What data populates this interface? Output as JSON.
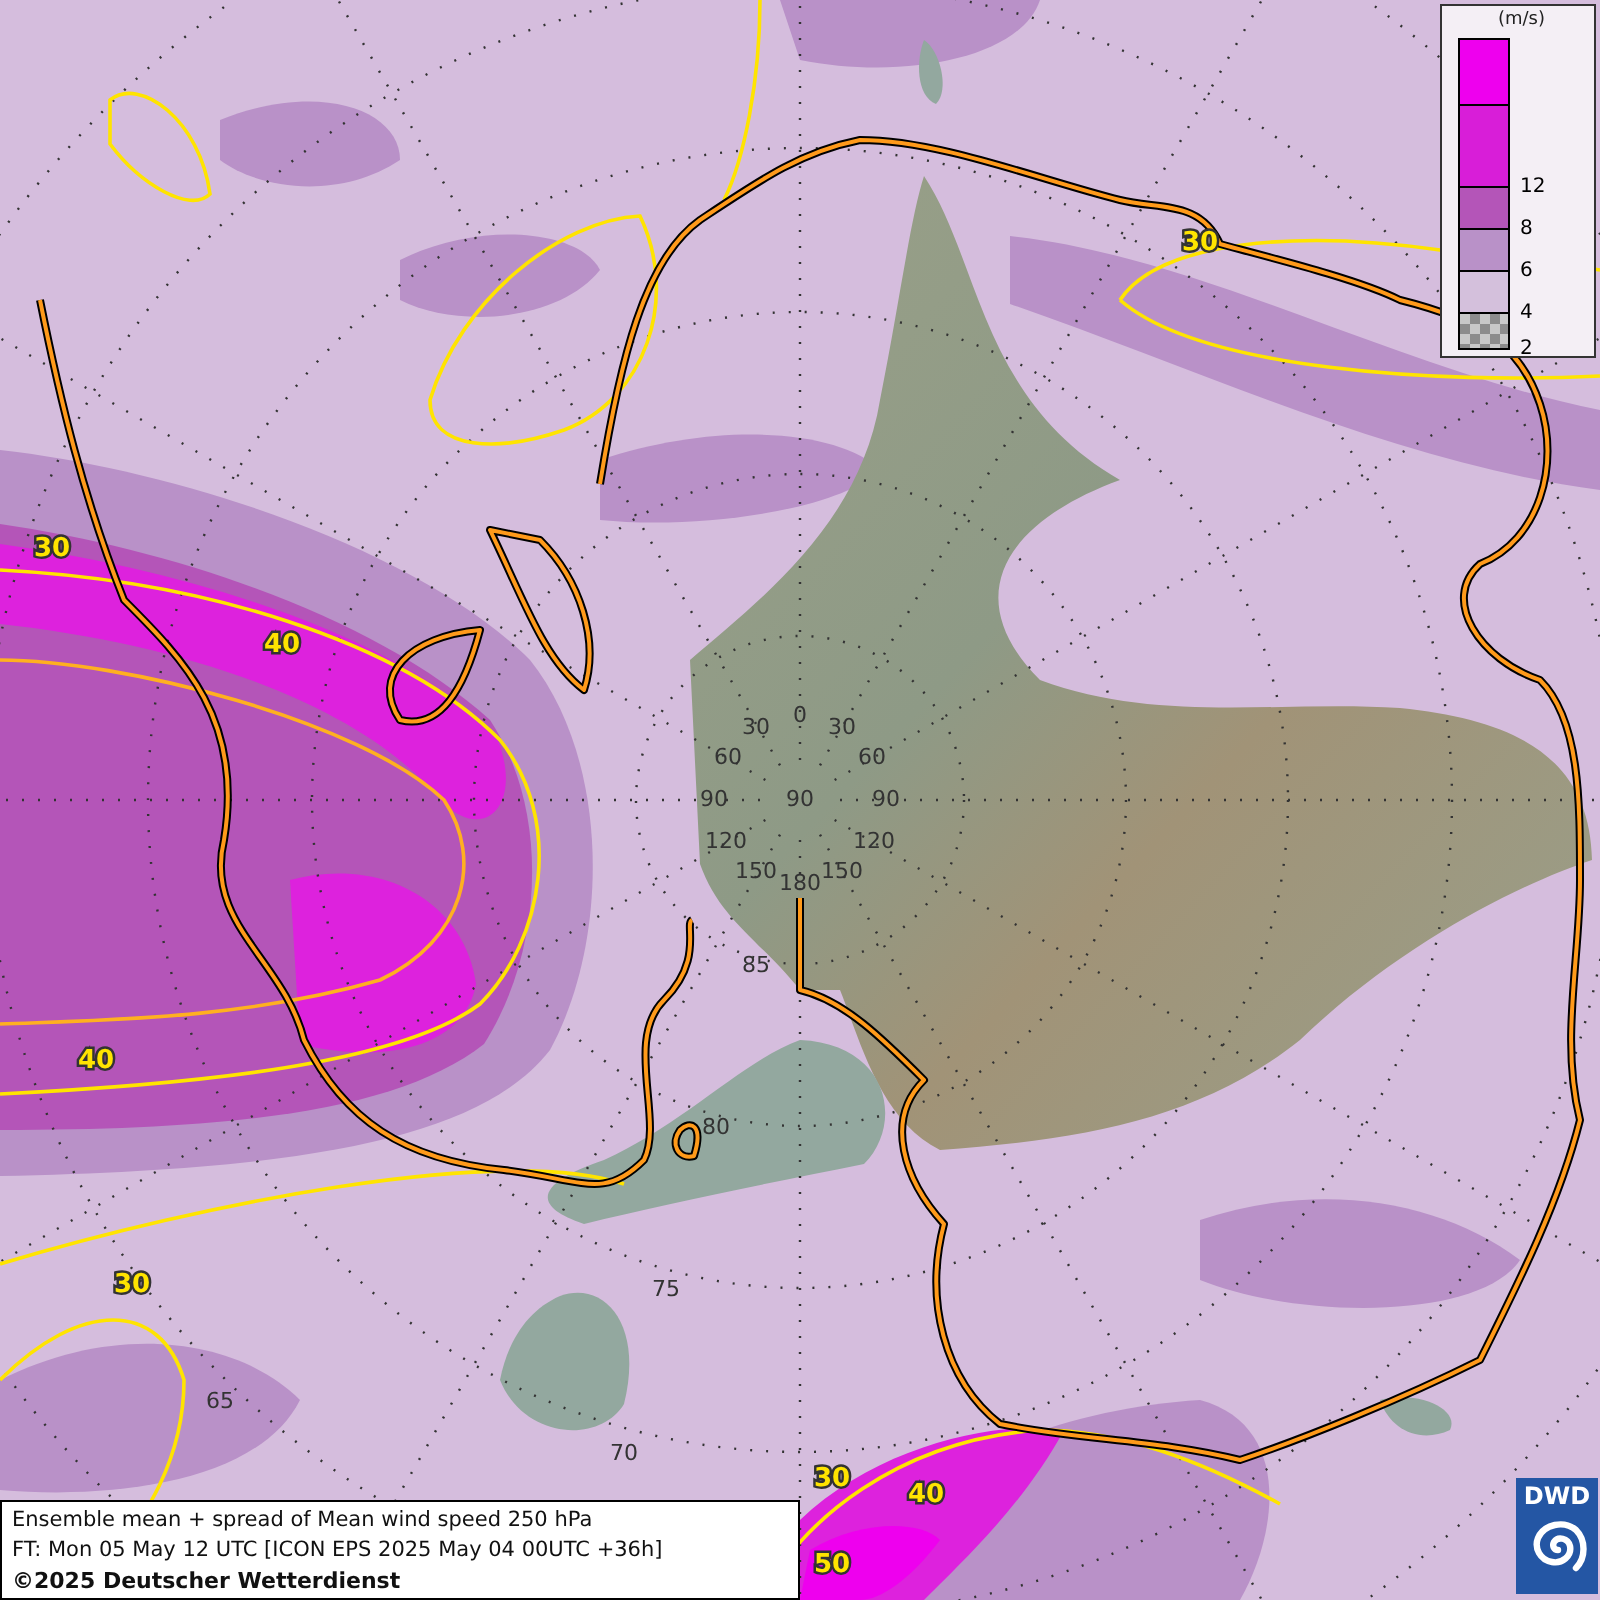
{
  "map": {
    "contour_labels": [
      "30",
      "30",
      "40",
      "40",
      "30",
      "30",
      "40",
      "50"
    ],
    "meridian_labels": [
      "0",
      "30",
      "30",
      "60",
      "60",
      "90",
      "90",
      "90",
      "120",
      "120",
      "150",
      "150",
      "180"
    ],
    "latitude_labels": [
      "85",
      "80",
      "75",
      "70",
      "65"
    ]
  },
  "legend": {
    "unit": "(m/s)",
    "bins": [
      {
        "kind": "solid",
        "color": "#ee00ee"
      },
      {
        "kind": "solid",
        "color": "#d81ed8",
        "tick": "12"
      },
      {
        "kind": "solid",
        "color": "#b455b8",
        "tick": "8"
      },
      {
        "kind": "solid",
        "color": "#b991c8",
        "tick": "6"
      },
      {
        "kind": "solid",
        "color": "#d4c0dc",
        "tick": "4"
      },
      {
        "kind": "checker",
        "tick": "2"
      }
    ]
  },
  "caption": {
    "title": "Ensemble mean + spread of Mean wind speed 250 hPa",
    "forecast_time": "FT: Mon 05 May 12 UTC [ICON EPS 2025 May 04 00UTC +36h]",
    "copyright": "©2025 Deutscher Wetterdienst"
  },
  "logo": {
    "text": "DWD"
  }
}
